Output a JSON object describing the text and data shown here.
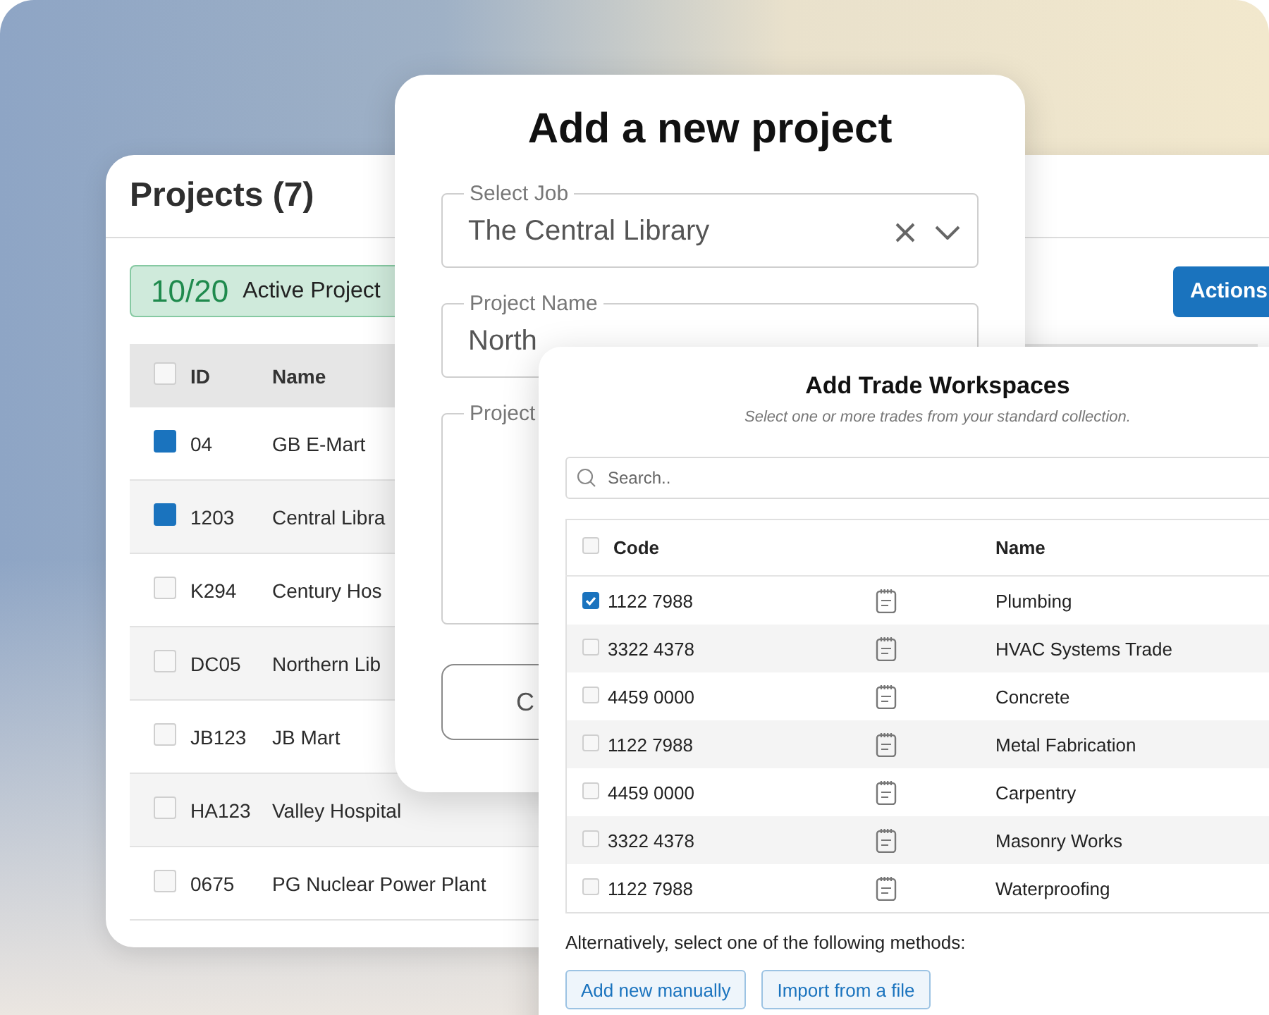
{
  "projects_panel": {
    "title": "Projects (7)",
    "badge": {
      "count": "10/20",
      "label": "Active Project"
    },
    "actions_button": "Actions",
    "table": {
      "select_all_checked": false,
      "columns": [
        "ID",
        "Name"
      ],
      "rows": [
        {
          "id": "04",
          "name": "GB E-Mart",
          "checked": true
        },
        {
          "id": "1203",
          "name": "Central Libra",
          "checked": true
        },
        {
          "id": "K294",
          "name": "Century Hos",
          "checked": false
        },
        {
          "id": "DC05",
          "name": "Northern Lib",
          "checked": false
        },
        {
          "id": "JB123",
          "name": "JB Mart",
          "checked": false
        },
        {
          "id": "HA123",
          "name": "Valley Hospital",
          "checked": false
        },
        {
          "id": "0675",
          "name": "PG Nuclear Power Plant",
          "checked": false
        }
      ]
    }
  },
  "new_project_dialog": {
    "title": "Add a new project",
    "fields": [
      {
        "kind": "select",
        "label": "Select Job",
        "value": "The Central Library"
      },
      {
        "kind": "text",
        "label": "Project Name",
        "value": "North"
      },
      {
        "kind": "textarea",
        "label": "Project"
      }
    ],
    "button": "C"
  },
  "trade_dialog": {
    "title": "Add Trade Workspaces",
    "subtitle": "Select one or more trades from your standard collection.",
    "search": {
      "placeholder": "Search.."
    },
    "table": {
      "select_all_checked": false,
      "columns": [
        "Code",
        "Name"
      ],
      "rows": [
        {
          "code": "1122 7988",
          "name": "Plumbing",
          "checked": true
        },
        {
          "code": "3322 4378",
          "name": "HVAC Systems Trade",
          "checked": false
        },
        {
          "code": "4459 0000",
          "name": "Concrete",
          "checked": false
        },
        {
          "code": "1122 7988",
          "name": "Metal Fabrication",
          "checked": false
        },
        {
          "code": "4459 0000",
          "name": "Carpentry",
          "checked": false
        },
        {
          "code": "3322 4378",
          "name": "Masonry Works",
          "checked": false
        },
        {
          "code": "1122 7988",
          "name": "Waterproofing",
          "checked": false
        }
      ]
    },
    "note": "Alternatively, select one of the following methods:",
    "buttons": [
      "Add new manually",
      "Import from a file"
    ]
  }
}
